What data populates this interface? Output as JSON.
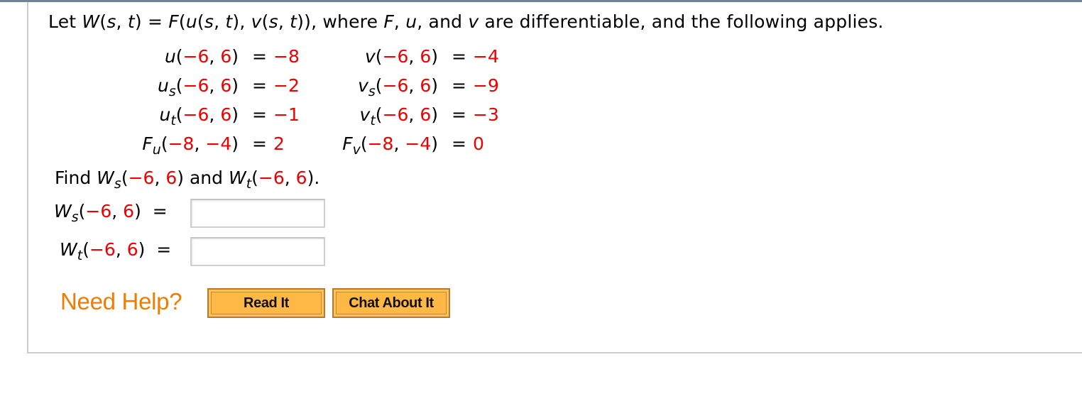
{
  "problem": {
    "intro_prefix": "Let ",
    "W_def": "W(s, t) = F(u(s, t), v(s, t)), where F, u, and v are differentiable, and the following applies.",
    "statement_parts": {
      "let": "Let ",
      "W": "W",
      "st1": "(s, t)",
      "eq": " = ",
      "F": "F",
      "inner": "(u(s, t), v(s, t))",
      "rest1": ", where ",
      "Fvar": "F",
      "comma": ", ",
      "uvar": "u",
      "and": ", and ",
      "vvar": "v",
      "rest2": " are differentiable, and the following applies."
    },
    "given": {
      "left": [
        {
          "func": "u",
          "sub": "",
          "args": [
            "−6",
            "6"
          ],
          "value": "−8"
        },
        {
          "func": "u",
          "sub": "s",
          "args": [
            "−6",
            "6"
          ],
          "value": "−2"
        },
        {
          "func": "u",
          "sub": "t",
          "args": [
            "−6",
            "6"
          ],
          "value": "−1"
        },
        {
          "func": "F",
          "sub": "u",
          "args": [
            "−8",
            "−4"
          ],
          "value": "2"
        }
      ],
      "right": [
        {
          "func": "v",
          "sub": "",
          "args": [
            "−6",
            "6"
          ],
          "value": "−4"
        },
        {
          "func": "v",
          "sub": "s",
          "args": [
            "−6",
            "6"
          ],
          "value": "−9"
        },
        {
          "func": "v",
          "sub": "t",
          "args": [
            "−6",
            "6"
          ],
          "value": "−3"
        },
        {
          "func": "F",
          "sub": "v",
          "args": [
            "−8",
            "−4"
          ],
          "value": "0"
        }
      ]
    },
    "find": {
      "prefix": "Find ",
      "a_func": "W",
      "a_sub": "s",
      "a_args": [
        "−6",
        "6"
      ],
      "middle": " and ",
      "b_func": "W",
      "b_sub": "t",
      "b_args": [
        "−6",
        "6"
      ],
      "suffix": "."
    },
    "answers": [
      {
        "func": "W",
        "sub": "s",
        "args": [
          "−6",
          "6"
        ],
        "value": "",
        "placeholder": ""
      },
      {
        "func": "W",
        "sub": "t",
        "args": [
          "−6",
          "6"
        ],
        "value": "",
        "placeholder": ""
      }
    ]
  },
  "help": {
    "label": "Need Help?",
    "read_it": "Read It",
    "chat_about_it": "Chat About It"
  },
  "colors": {
    "value_red": "#ee0000",
    "help_orange": "#ee7d00",
    "button_fill": "#fdb845",
    "top_bar": "#6e8595"
  }
}
